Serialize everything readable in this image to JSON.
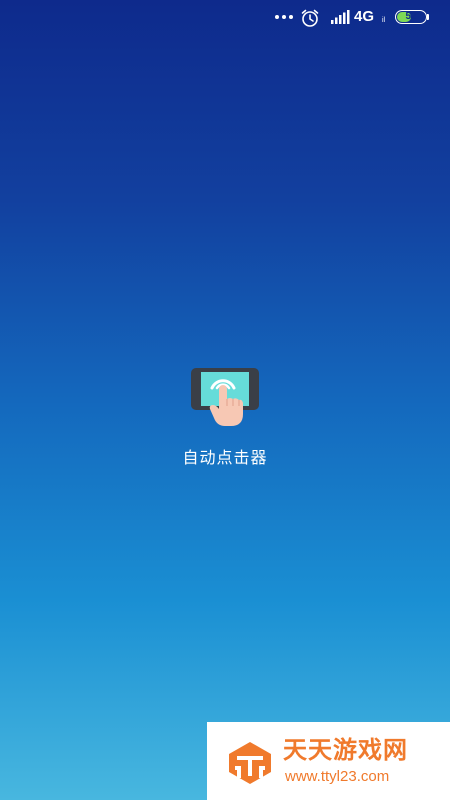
{
  "status_bar": {
    "network": "4G",
    "network_sub": "il",
    "battery_level": "52",
    "battery_fraction": 0.52,
    "icons": [
      "more-dots-icon",
      "alarm-clock-icon",
      "cellular-signal-icon",
      "battery-icon"
    ]
  },
  "app": {
    "label": "自动点击器",
    "icon": "tap-hand-phone-icon"
  },
  "watermark": {
    "title": "天天游戏网",
    "url": "www.ttyl23.com",
    "icon": "ttyl-logo-icon"
  },
  "colors": {
    "background_top": "#0e2a8c",
    "background_bottom": "#48b7df",
    "watermark_orange": "#f07a2c",
    "battery_green": "#7ed957"
  }
}
